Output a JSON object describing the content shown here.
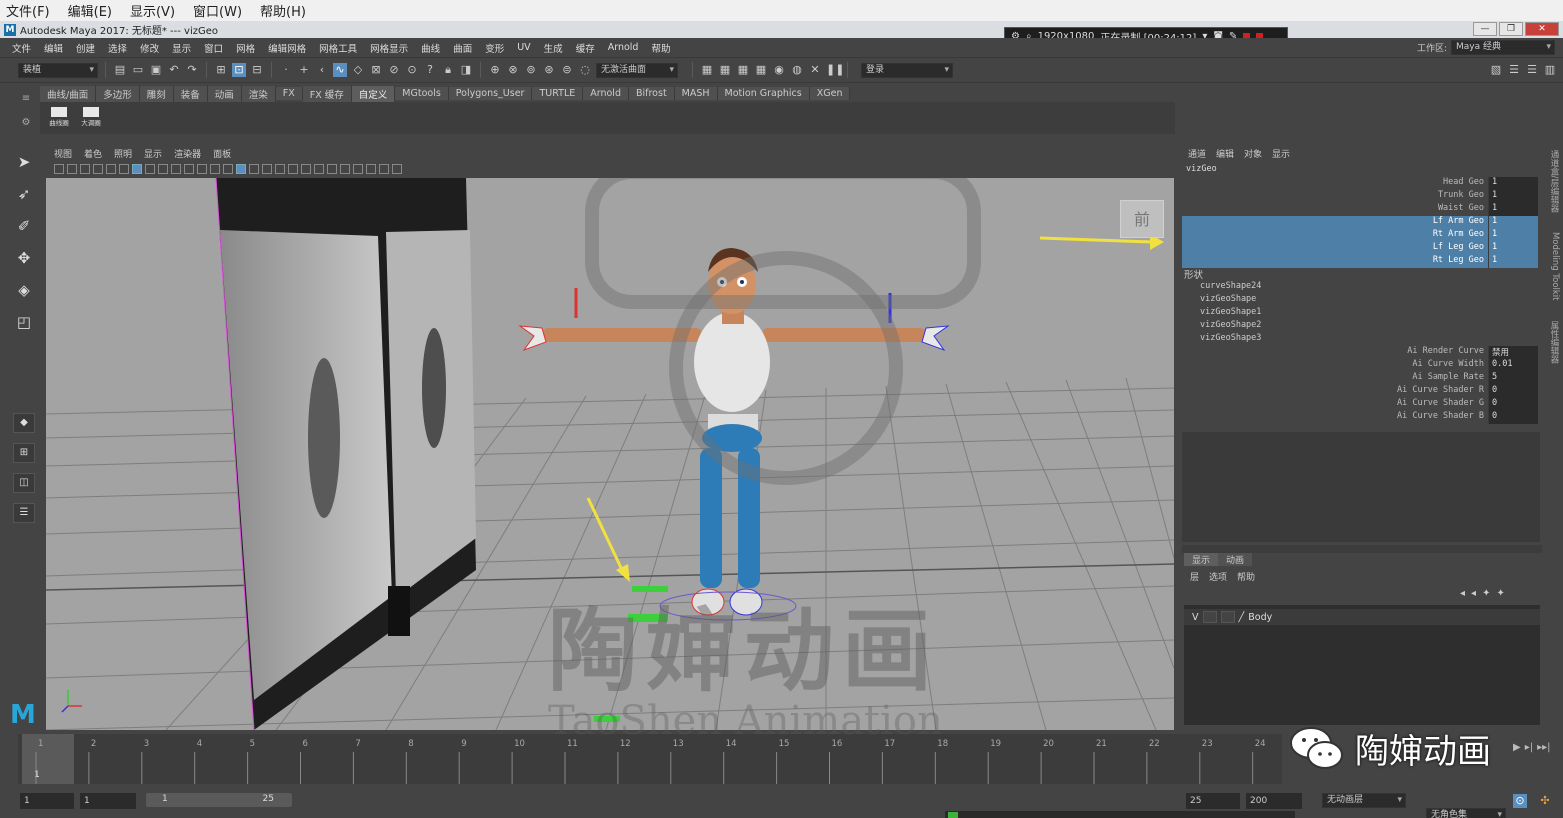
{
  "host_menu": [
    "文件(F)",
    "编辑(E)",
    "显示(V)",
    "窗口(W)",
    "帮助(H)"
  ],
  "title": "Autodesk Maya 2017: 无标题*   ---   vizGeo",
  "recorder": {
    "resolution": "1920x1080",
    "status": "正在录制 [00:24:12]"
  },
  "maya_menu": [
    "文件",
    "编辑",
    "创建",
    "选择",
    "修改",
    "显示",
    "窗口",
    "网格",
    "编辑网格",
    "网格工具",
    "网格显示",
    "曲线",
    "曲面",
    "变形",
    "UV",
    "生成",
    "缓存",
    "Arnold",
    "帮助"
  ],
  "workspace": {
    "label": "工作区:",
    "value": "Maya 经典"
  },
  "status_line": {
    "mode": "装植",
    "live_surface": "无激活曲面",
    "login": "登录"
  },
  "shelf_tabs": [
    "曲线/曲面",
    "多边形",
    "雕刻",
    "装备",
    "动画",
    "渲染",
    "FX",
    "FX 缓存",
    "自定义",
    "MGtools",
    "Polygons_User",
    "TURTLE",
    "Arnold",
    "Bifrost",
    "MASH",
    "Motion Graphics",
    "XGen"
  ],
  "shelf_active": "自定义",
  "shelf_items": [
    "曲线圈",
    "大调圈"
  ],
  "viewport_menu": [
    "视图",
    "着色",
    "照明",
    "显示",
    "渲染器",
    "面板"
  ],
  "view_cube_label": "前",
  "channel_box": {
    "menu": [
      "通道",
      "编辑",
      "对象",
      "显示"
    ],
    "object": "vizGeo",
    "attributes": [
      {
        "name": "Head Geo",
        "value": "1",
        "selected": false
      },
      {
        "name": "Trunk Geo",
        "value": "1",
        "selected": false
      },
      {
        "name": "Waist Geo",
        "value": "1",
        "selected": false
      },
      {
        "name": "Lf Arm Geo",
        "value": "1",
        "selected": true
      },
      {
        "name": "Rt Arm Geo",
        "value": "1",
        "selected": true
      },
      {
        "name": "Lf Leg Geo",
        "value": "1",
        "selected": true
      },
      {
        "name": "Rt Leg Geo",
        "value": "1",
        "selected": true
      }
    ],
    "shapes_label": "形状",
    "shapes": [
      "curveShape24",
      "vizGeoShape",
      "vizGeoShape1",
      "vizGeoShape2",
      "vizGeoShape3"
    ],
    "shape_attributes": [
      {
        "name": "Ai Render Curve",
        "value": "禁用"
      },
      {
        "name": "Ai Curve Width",
        "value": "0.01"
      },
      {
        "name": "Ai Sample Rate",
        "value": "5"
      },
      {
        "name": "Ai Curve Shader R",
        "value": "0"
      },
      {
        "name": "Ai Curve Shader G",
        "value": "0"
      },
      {
        "name": "Ai Curve Shader B",
        "value": "0"
      }
    ]
  },
  "side_tabs": [
    "通道盒/层编辑器",
    "Modeling Toolkit",
    "属性编辑器"
  ],
  "layer_editor": {
    "tabs": [
      "显示",
      "动画"
    ],
    "menu": [
      "层",
      "选项",
      "帮助"
    ],
    "layer": {
      "visibility": "V",
      "name": "Body"
    }
  },
  "timeline": {
    "ticks": [
      "1",
      "2",
      "3",
      "4",
      "5",
      "6",
      "7",
      "8",
      "9",
      "10",
      "11",
      "12",
      "13",
      "14",
      "15",
      "16",
      "17",
      "18",
      "19",
      "20",
      "21",
      "22",
      "23",
      "24"
    ],
    "current": "1"
  },
  "range": {
    "start": "1",
    "playback_start": "1",
    "slider_start": "1",
    "slider_end": "25",
    "playback_end": "25",
    "end": "200",
    "anim_layer": "无动画层",
    "character": "无角色集"
  },
  "watermark": {
    "cn": "陶婶动画",
    "en": "TaoShen Animation",
    "badge": "陶婶动画"
  },
  "colors": {
    "selection": "#4d7fa7",
    "viewport_bg": "#a3a3a3",
    "arrow": "#f0e040"
  }
}
